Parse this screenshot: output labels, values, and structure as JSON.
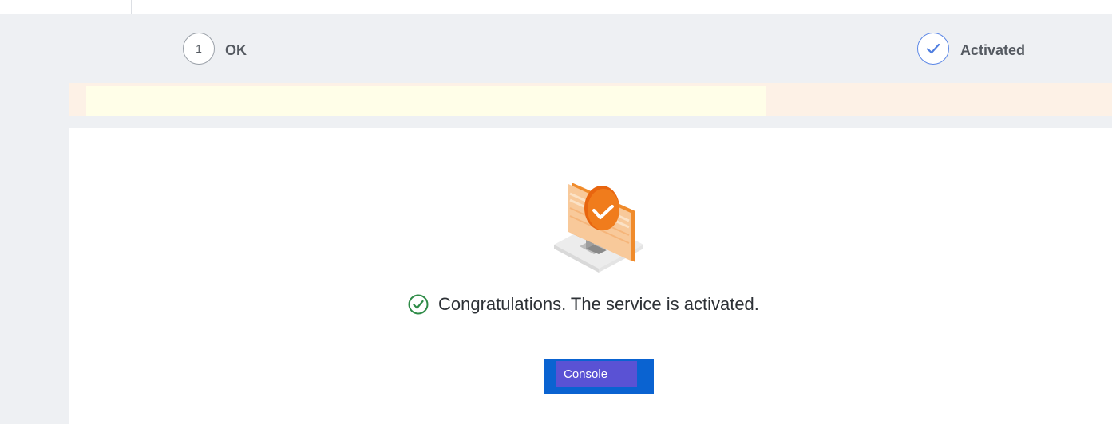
{
  "stepper": {
    "steps": [
      {
        "number": "1",
        "label": "OK",
        "state": "default"
      },
      {
        "number": "✓",
        "label": "Activated",
        "state": "active"
      }
    ]
  },
  "result": {
    "message": "Congratulations. The service is activated.",
    "status": "success",
    "illustration": "monitor-check-illustration"
  },
  "actions": {
    "console_label": "Console"
  },
  "colors": {
    "page_background": "#eef0f3",
    "panel_background": "#ffffff",
    "notice_background": "#fdf1e6",
    "success_green": "#2e8b47",
    "active_step_blue": "#5a86e6",
    "button_blue": "#0a63d1",
    "button_inner": "#5a52d4",
    "illustration_orange": "#f07c1c"
  }
}
